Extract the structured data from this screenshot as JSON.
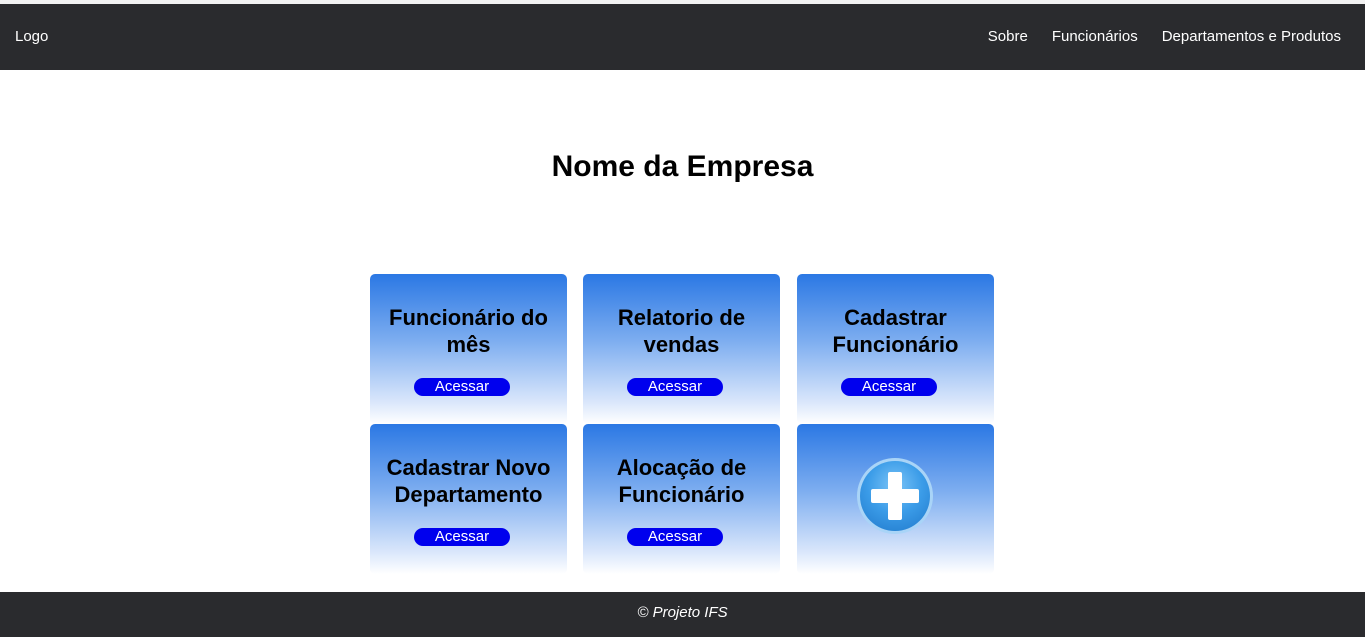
{
  "nav": {
    "logo": "Logo",
    "links": [
      "Sobre",
      "Funcionários",
      "Departamentos e Produtos"
    ]
  },
  "main": {
    "title": "Nome da Empresa",
    "cards": [
      {
        "title": "Funcionário do mês",
        "button": "Acessar"
      },
      {
        "title": "Relatorio de vendas",
        "button": "Acessar"
      },
      {
        "title": "Cadastrar Funcionário",
        "button": "Acessar"
      },
      {
        "title": "Cadastrar Novo Departamento",
        "button": "Acessar"
      },
      {
        "title": "Alocação de Funcionário",
        "button": "Acessar"
      },
      {
        "icon": "plus-icon"
      }
    ]
  },
  "footer": {
    "text": "© Projeto IFS"
  },
  "colors": {
    "navbar_bg": "#2a2b2e",
    "card_gradient_top": "#2b78e4",
    "button_bg": "#0000ee",
    "plus_circle": "#3b9ce8"
  }
}
